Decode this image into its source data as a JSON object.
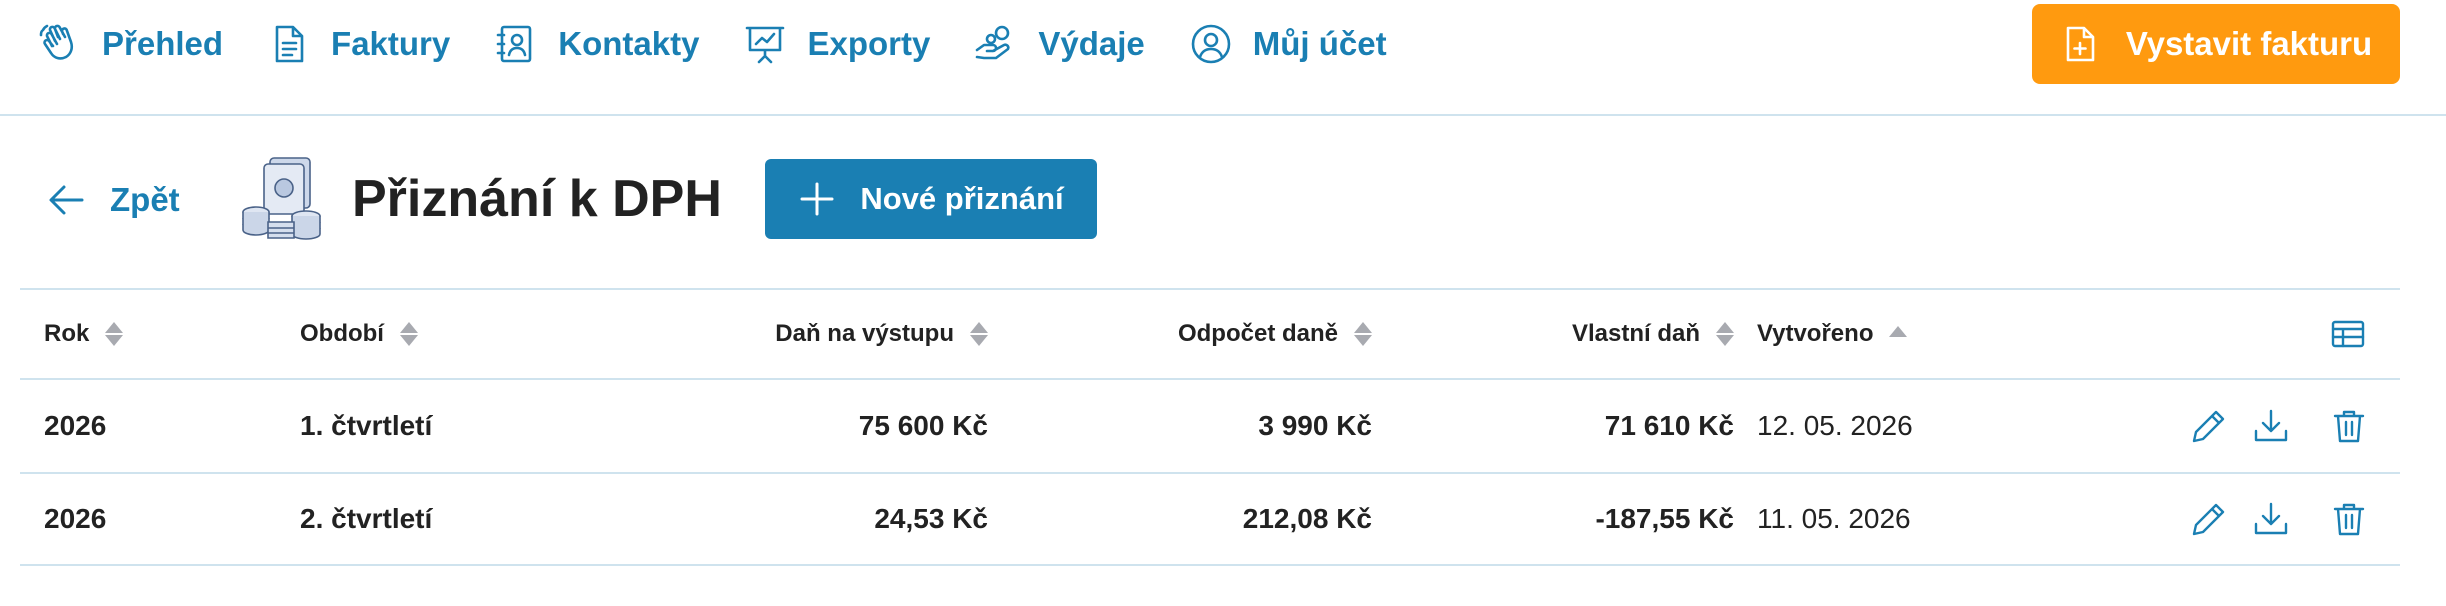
{
  "nav": {
    "items": [
      {
        "label": "Přehled",
        "icon": "waving-hand-icon"
      },
      {
        "label": "Faktury",
        "icon": "document-icon"
      },
      {
        "label": "Kontakty",
        "icon": "contact-card-icon"
      },
      {
        "label": "Exporty",
        "icon": "presentation-board-icon"
      },
      {
        "label": "Výdaje",
        "icon": "hand-coins-icon"
      },
      {
        "label": "Můj účet",
        "icon": "user-circle-icon"
      }
    ],
    "cta_label": "Vystavit fakturu"
  },
  "header": {
    "back_label": "Zpět",
    "title": "Přiznání k DPH",
    "new_button_label": "Nové přiznání"
  },
  "table": {
    "columns": {
      "rok": "Rok",
      "obdobi": "Období",
      "dan_na_vystupu": "Daň na výstupu",
      "odpocet_dane": "Odpočet daně",
      "vlastni_dan": "Vlastní daň",
      "vytvoreno": "Vytvořeno"
    },
    "rows": [
      {
        "rok": "2026",
        "obdobi": "1. čtvrtletí",
        "dan_na_vystupu": "75 600 Kč",
        "odpocet_dane": "3 990 Kč",
        "vlastni_dan": "71 610 Kč",
        "vytvoreno": "12. 05. 2026"
      },
      {
        "rok": "2026",
        "obdobi": "2. čtvrtletí",
        "dan_na_vystupu": "24,53 Kč",
        "odpocet_dane": "212,08 Kč",
        "vlastni_dan": "-187,55 Kč",
        "vytvoreno": "11. 05. 2026"
      }
    ]
  },
  "colors": {
    "accent": "#1a7fb3",
    "cta": "#ff9a0f",
    "divider": "#cfe3ee",
    "text": "#222222"
  }
}
